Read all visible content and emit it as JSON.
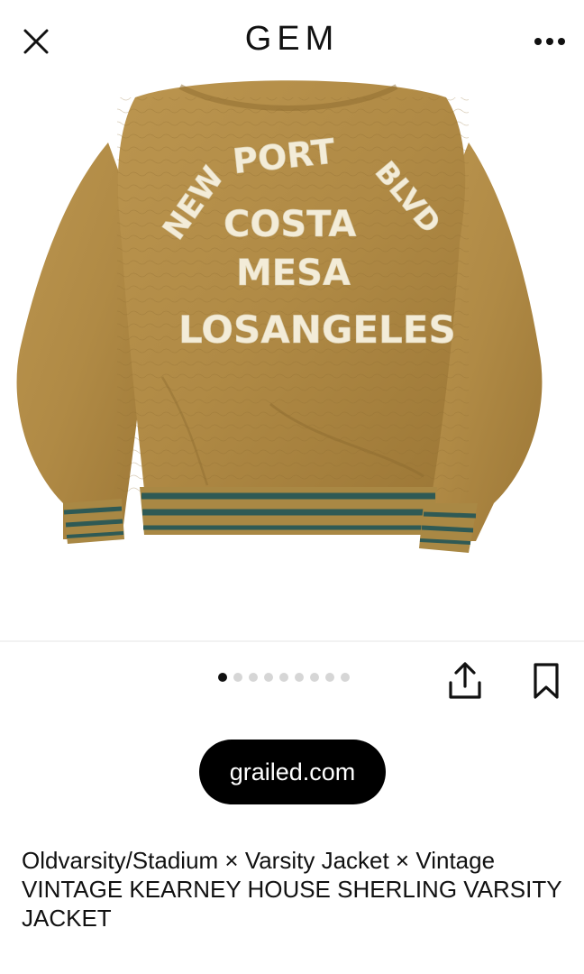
{
  "header": {
    "logo": "GEM",
    "close_icon": "close-icon",
    "more_icon": "more-horizontal-icon"
  },
  "product_image": {
    "description_icon": "jacket-photo",
    "patch_text": {
      "arc_left": "NEW",
      "arc_mid": "PORT",
      "arc_right": "BLVD",
      "line1": "COSTA",
      "line2": "MESA",
      "line3": "LOSANGELES"
    },
    "colors": {
      "jacket": "#b08a45",
      "jacket_shadow": "#8e6c30",
      "stripe": "#2f5a55",
      "lettering": "#f3ecd8"
    }
  },
  "carousel": {
    "total": 9,
    "active_index": 0
  },
  "actions": {
    "share_icon": "share-icon",
    "save_icon": "bookmark-icon"
  },
  "source": {
    "label": "grailed.com"
  },
  "listing": {
    "title_line1": "Oldvarsity/Stadium × Varsity Jacket × Vintage",
    "title_line2": "VINTAGE KEARNEY HOUSE SHERLING VARSITY",
    "title_line3": "JACKET"
  }
}
